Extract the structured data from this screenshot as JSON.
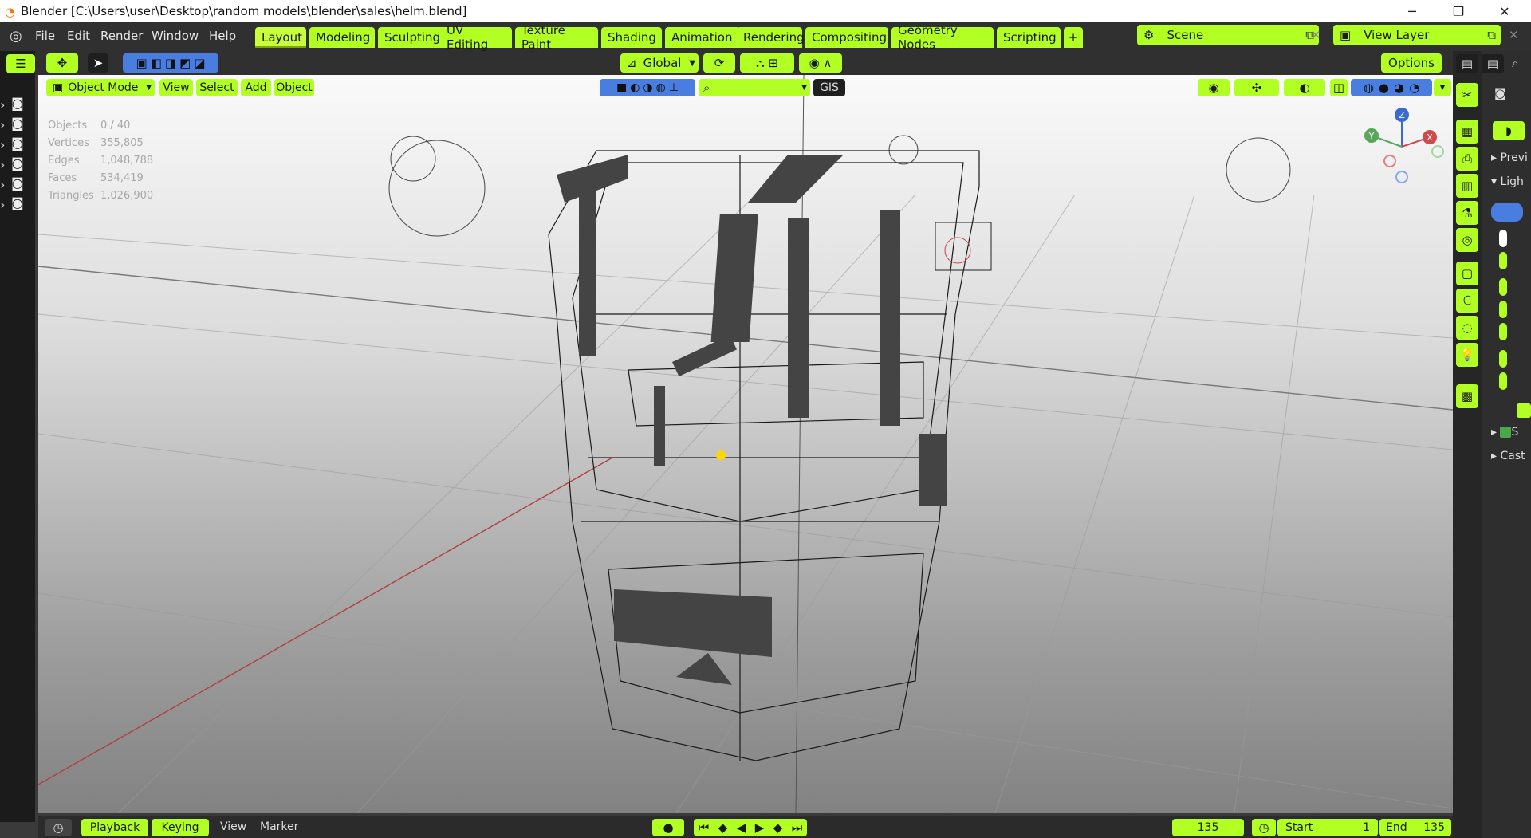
{
  "window": {
    "title": "Blender [C:\\Users\\user\\Desktop\\random models\\blender\\sales\\helm.blend]",
    "controls": [
      "─",
      "❐",
      "✕"
    ]
  },
  "menu": [
    "File",
    "Edit",
    "Render",
    "Window",
    "Help"
  ],
  "workspaces": [
    "Layout",
    "Modeling",
    "Sculpting",
    "UV Editing",
    "Texture Paint",
    "Shading",
    "Animation",
    "Rendering",
    "Compositing",
    "Geometry Nodes",
    "Scripting",
    "+"
  ],
  "active_workspace": "Layout",
  "scene": {
    "name": "Scene",
    "view_layer": "View Layer"
  },
  "toolbar": {
    "orientation": "Global",
    "options": "Options"
  },
  "viewport_header": {
    "mode": "Object Mode",
    "menus": [
      "View",
      "Select",
      "Add",
      "Object"
    ],
    "gis": "GIS"
  },
  "stats": {
    "labels": [
      "Objects",
      "Vertices",
      "Edges",
      "Faces",
      "Triangles"
    ],
    "values": [
      "0 / 40",
      "355,805",
      "1,048,788",
      "534,419",
      "1,026,900"
    ]
  },
  "gizmo": {
    "z": "Z",
    "y": "Y",
    "x": "X"
  },
  "properties_panel": {
    "items": [
      "Previ",
      "Ligh",
      "S",
      "Cast"
    ]
  },
  "timeline": {
    "playback": "Playback",
    "keying": "Keying",
    "view": "View",
    "marker": "Marker",
    "current_frame": "135",
    "start_label": "Start",
    "start_value": "1",
    "end_label": "End",
    "end_value": "135"
  },
  "colors": {
    "accent": "#b2ff24",
    "header": "#303030",
    "viewport_top": "#fafafa"
  }
}
